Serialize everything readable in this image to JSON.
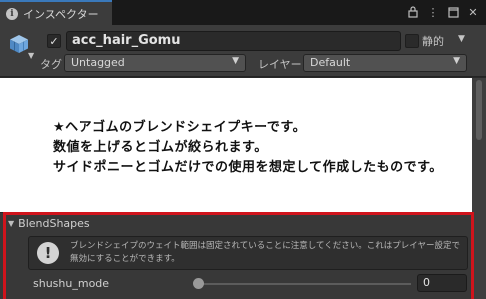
{
  "tab": {
    "label": "インスペクター"
  },
  "toolbar": {
    "lock_icon": "lock-icon",
    "menu_icon": "kebab-menu-icon",
    "maximize_icon": "maximize-icon",
    "close_icon": "close-icon"
  },
  "header": {
    "object_name": "acc_hair_Gomu",
    "active_checked": true,
    "static_label": "静的",
    "static_checked": false,
    "tag_label": "タグ",
    "tag_value": "Untagged",
    "layer_label": "レイヤー",
    "layer_value": "Default"
  },
  "preview": {
    "lines": [
      "★ヘアゴムのブレンドシェイプキーです。",
      "数値を上げるとゴムが絞られます。",
      "サイドポニーとゴムだけでの使用を想定して作成したものです。"
    ]
  },
  "blendshapes": {
    "title": "BlendShapes",
    "help_text": "ブレンドシェイプのウェイト範囲は固定されていることに注意してください。これはプレイヤー設定で無効にすることができます。",
    "rows": [
      {
        "name": "shushu_mode",
        "value": "0",
        "fraction": 0
      }
    ]
  },
  "colors": {
    "accent_tab": "#3a79bb",
    "highlight_frame": "#d0141c",
    "panel": "#3c3c3c"
  }
}
